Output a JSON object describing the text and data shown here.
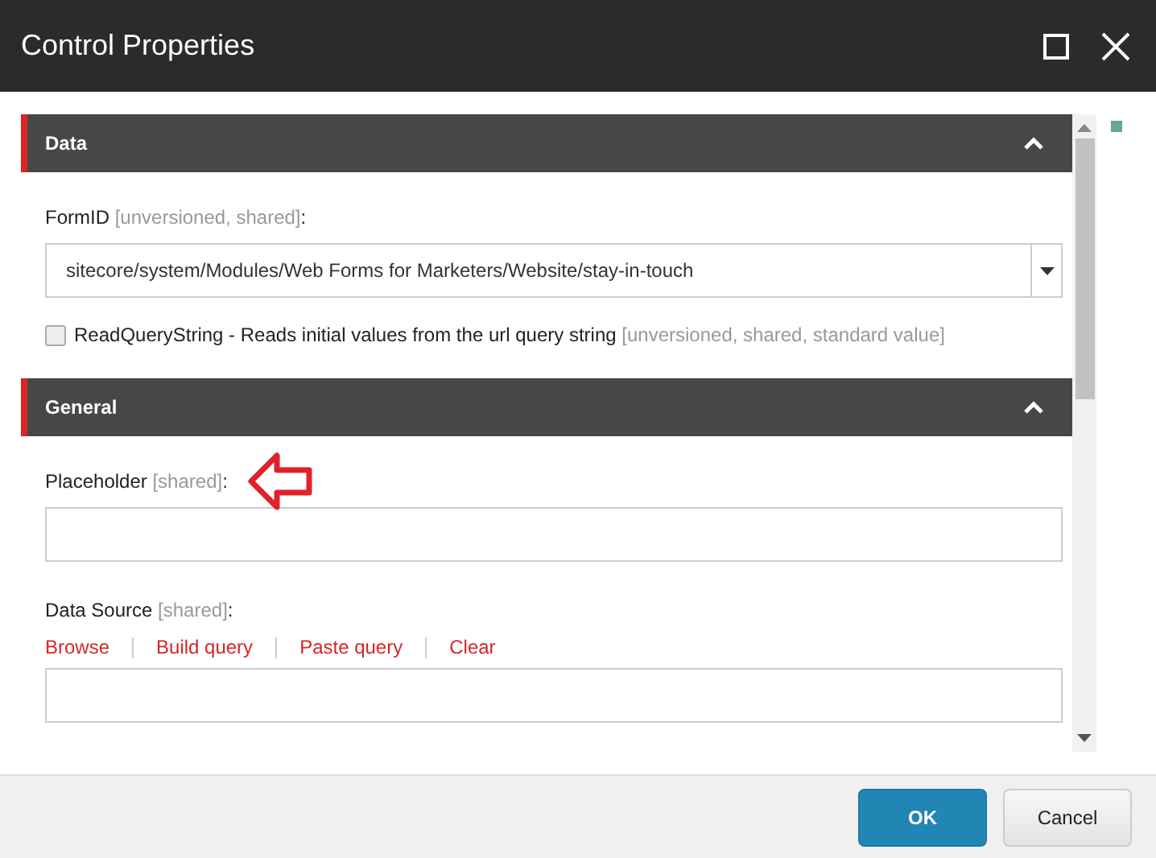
{
  "window": {
    "title": "Control Properties"
  },
  "sections": [
    {
      "title": "Data",
      "expanded": true,
      "fields": [
        {
          "kind": "select",
          "label": "FormID",
          "note": "[unversioned, shared]",
          "suffix": ":",
          "value": "sitecore/system/Modules/Web Forms for Marketers/Website/stay-in-touch"
        },
        {
          "kind": "checkbox",
          "label": "ReadQueryString - Reads initial values from the url query string",
          "note": "[unversioned, shared, standard value]",
          "checked": false
        }
      ]
    },
    {
      "title": "General",
      "expanded": true,
      "fields": [
        {
          "kind": "text",
          "label": "Placeholder",
          "note": "[shared]",
          "suffix": ":",
          "annotated": true
        },
        {
          "kind": "linkfield",
          "label": "Data Source",
          "note": "[shared]",
          "suffix": ":",
          "links": [
            "Browse",
            "Build query",
            "Paste query",
            "Clear"
          ]
        }
      ]
    }
  ],
  "buttons": [
    {
      "label": "OK",
      "primary": true
    },
    {
      "label": "Cancel",
      "primary": false
    }
  ]
}
